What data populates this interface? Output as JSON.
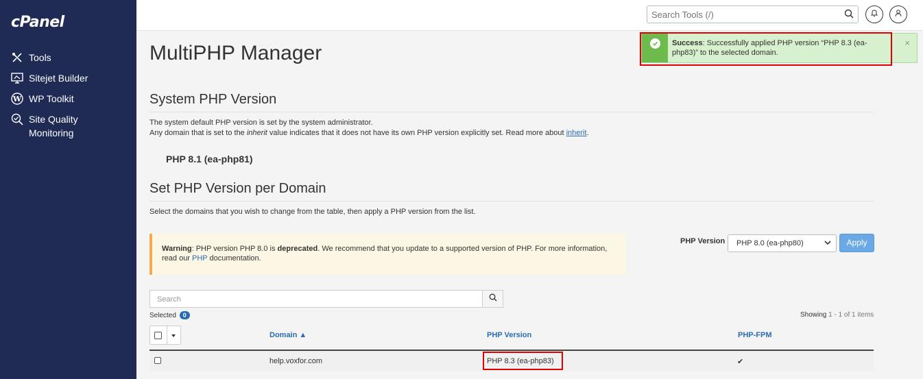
{
  "brand": {
    "logo_text": "cPanel"
  },
  "sidebar": {
    "items": [
      {
        "label": "Tools",
        "icon": "tools-icon"
      },
      {
        "label": "Sitejet Builder",
        "icon": "monitor-icon"
      },
      {
        "label": "WP Toolkit",
        "icon": "wordpress-icon"
      },
      {
        "label": "Site Quality Monitoring",
        "icon": "search-check-icon"
      }
    ]
  },
  "header": {
    "search_placeholder": "Search Tools (/)"
  },
  "alert": {
    "strong": "Success",
    "message": ": Successfully applied PHP version “PHP 8.3 (ea-php83)” to the selected domain.",
    "close": "×"
  },
  "page": {
    "title": "MultiPHP Manager",
    "system_section": {
      "title": "System PHP Version",
      "line1": "The system default PHP version is set by the system administrator.",
      "line2_pre": "Any domain that is set to the ",
      "line2_em": "inherit",
      "line2_post": " value indicates that it does not have its own PHP version explicitly set. Read more about ",
      "line2_link": "inherit",
      "line2_end": ".",
      "current_version": "PHP 8.1 (ea-php81)"
    },
    "domain_section": {
      "title": "Set PHP Version per Domain",
      "description": "Select the domains that you wish to change from the table, then apply a PHP version from the list."
    },
    "warning": {
      "label": "Warning",
      "pre": ": PHP version PHP 8.0 is ",
      "bold": "deprecated",
      "post": ". We recommend that you update to a supported version of PHP. For more information, read our ",
      "link": "PHP",
      "end": " documentation."
    },
    "php_version_control": {
      "label": "PHP Version",
      "selected": "PHP 8.0 (ea-php80)",
      "apply_label": "Apply"
    },
    "search": {
      "placeholder": "Search"
    },
    "selected": {
      "label": "Selected",
      "count": "0"
    },
    "showing": {
      "prefix": "Showing ",
      "range": "1 - 1 of 1 items"
    },
    "table": {
      "columns": [
        "Domain ▲",
        "PHP Version",
        "PHP-FPM"
      ],
      "rows": [
        {
          "domain": "help.voxfor.com",
          "php_version": "PHP 8.3 (ea-php83)",
          "php_fpm": "✔"
        }
      ]
    }
  },
  "colors": {
    "sidebar_bg": "#1f2a55",
    "accent": "#2b6cb0",
    "success_bg": "#d7f0cd",
    "success_bar": "#6dbb4d",
    "warning_bg": "#fcf6e4",
    "highlight": "#e00000"
  }
}
